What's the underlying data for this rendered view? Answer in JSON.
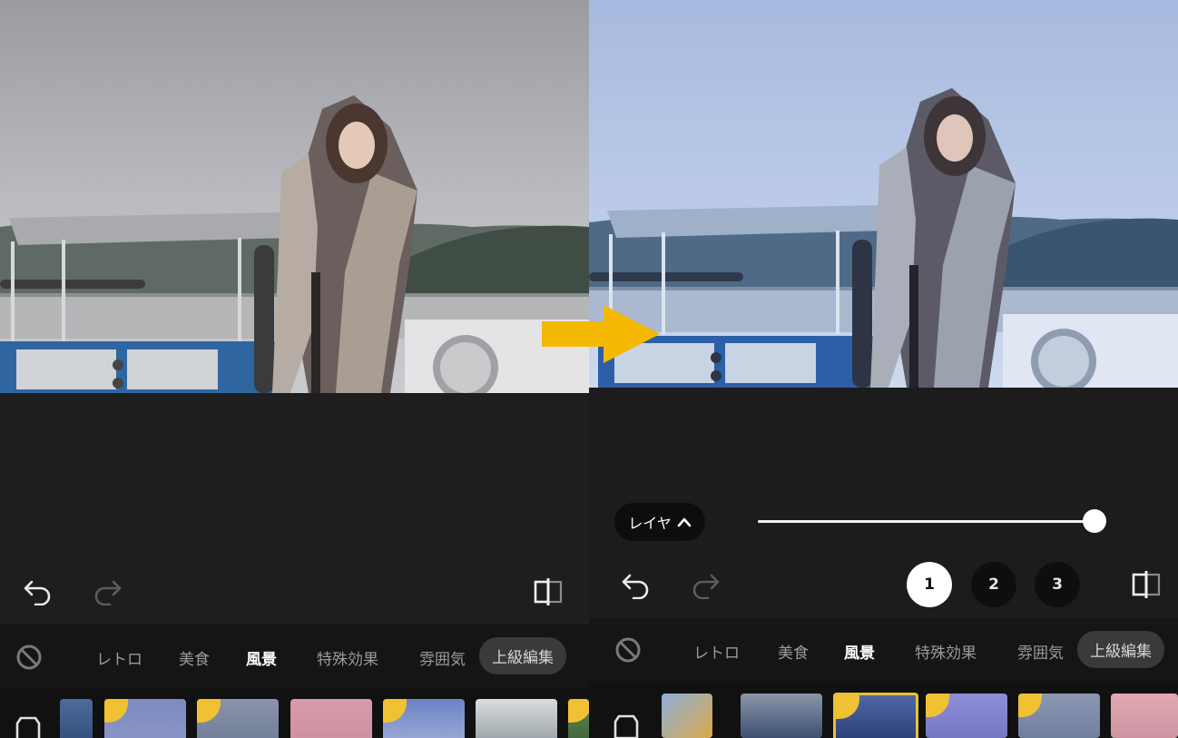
{
  "categories": {
    "retro": "レトロ",
    "food": "美食",
    "landscape": "風景",
    "special": "特殊効果",
    "mood": "雰囲気",
    "advanced": "上級編集"
  },
  "right": {
    "layer_button": "レイヤ",
    "slider": {
      "value": 1.0
    },
    "presets": [
      "1",
      "2",
      "3"
    ],
    "selected_preset": "1"
  },
  "colors": {
    "accent_arrow": "#f5b800",
    "crown": "#f0c233",
    "selected_thumb_border": "#e8c23a"
  },
  "icons": [
    "undo-icon",
    "redo-icon",
    "compare-icon",
    "no-filter-icon",
    "store-icon",
    "chevron-up-icon",
    "crown-icon"
  ]
}
